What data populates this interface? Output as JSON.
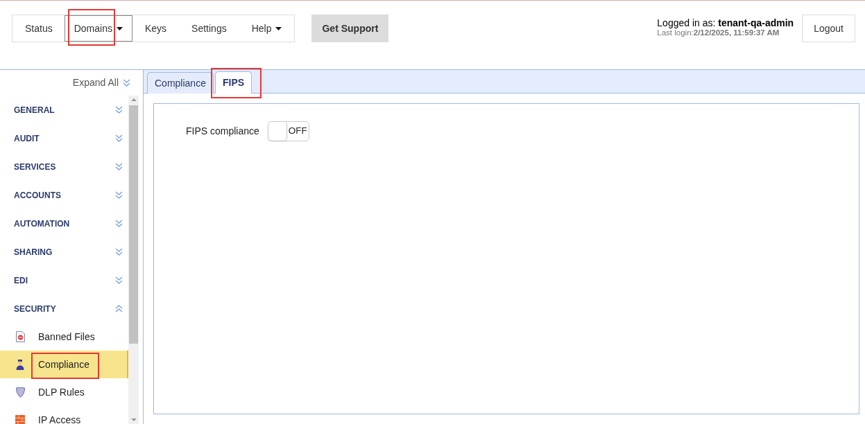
{
  "nav": {
    "items": [
      {
        "label": "Status",
        "dropdown": false,
        "selected": false,
        "highlighted": false
      },
      {
        "label": "Domains",
        "dropdown": true,
        "selected": true,
        "highlighted": true
      },
      {
        "label": "Keys",
        "dropdown": false,
        "selected": false,
        "highlighted": false
      },
      {
        "label": "Settings",
        "dropdown": false,
        "selected": false,
        "highlighted": false
      },
      {
        "label": "Help",
        "dropdown": true,
        "selected": false,
        "highlighted": false
      }
    ],
    "support_button": "Get Support"
  },
  "user": {
    "prefix": "Logged in as:",
    "name": "tenant-qa-admin",
    "last_login_label": "Last login:",
    "last_login": "2/12/2025, 11:59:37 AM",
    "logout": "Logout"
  },
  "sidebar": {
    "expand_all": "Expand All",
    "sections": [
      {
        "label": "GENERAL",
        "expanded": false
      },
      {
        "label": "AUDIT",
        "expanded": false
      },
      {
        "label": "SERVICES",
        "expanded": false
      },
      {
        "label": "ACCOUNTS",
        "expanded": false
      },
      {
        "label": "AUTOMATION",
        "expanded": false
      },
      {
        "label": "SHARING",
        "expanded": false
      },
      {
        "label": "EDI",
        "expanded": false
      },
      {
        "label": "SECURITY",
        "expanded": true,
        "children": [
          {
            "label": "Banned Files",
            "kind": "banned",
            "selected": false,
            "highlighted": false
          },
          {
            "label": "Compliance",
            "kind": "person",
            "selected": true,
            "highlighted": true
          },
          {
            "label": "DLP Rules",
            "kind": "shield",
            "selected": false,
            "highlighted": false
          },
          {
            "label": "IP Access",
            "kind": "wall",
            "selected": false,
            "highlighted": false
          }
        ]
      }
    ]
  },
  "tabs": [
    {
      "label": "Compliance",
      "selected": false,
      "highlighted": false
    },
    {
      "label": "FIPS",
      "selected": true,
      "highlighted": true
    }
  ],
  "panel": {
    "label": "FIPS compliance",
    "toggle": {
      "on": false,
      "text": "OFF"
    }
  }
}
